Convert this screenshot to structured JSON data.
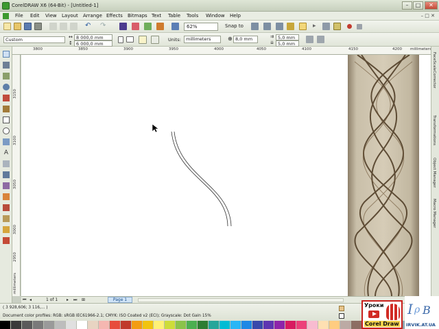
{
  "window": {
    "title": "CorelDRAW X6 (64-Bit) - [Untitled-1]"
  },
  "menu": {
    "items": [
      "File",
      "Edit",
      "View",
      "Layout",
      "Arrange",
      "Effects",
      "Bitmaps",
      "Text",
      "Table",
      "Tools",
      "Window",
      "Help"
    ]
  },
  "std_toolbar": {
    "zoom": "62%",
    "snap_to": "Snap to"
  },
  "property_bar": {
    "preset": "Custom",
    "page_width": "8 000,0 mm",
    "page_height": "6 000,0 mm",
    "units_label": "Units:",
    "units_value": "millimeters",
    "nudge": "8,0 mm",
    "dup_x": "5,0 mm",
    "dup_y": "5,0 mm"
  },
  "hruler": {
    "labels": [
      "3800",
      "3850",
      "3900",
      "3950",
      "4000",
      "4050",
      "4100",
      "4150",
      "4200"
    ],
    "unit": "millimeters"
  },
  "vruler": {
    "labels": [
      "3150",
      "3100",
      "3050",
      "3000",
      "2950",
      "2900"
    ],
    "unit": "millimeters"
  },
  "docker_tabs": [
    "FaceScaleCorrector",
    "Transformations",
    "Object Manager",
    "Macro Manager"
  ],
  "page_nav": {
    "counter": "1 of 1",
    "page_tab": "Page 1"
  },
  "status": {
    "coords": "( 3 928,606; 3 116,... )",
    "color_profiles": "Document color profiles: RGB: sRGB IEC61966-2.1; CMYK: ISO Coated v2 (ECI); Grayscale: Dot Gain 15%"
  },
  "logos": {
    "uroki_line1": "Уроки",
    "uroki_line2": "Corel Draw",
    "irvik_text": "IRVIK.AT.UA"
  },
  "palette": [
    "#000000",
    "#3a3a3a",
    "#5a5a5a",
    "#7a7a7a",
    "#9a9a9a",
    "#bdbdbd",
    "#e0e0e0",
    "#ffffff",
    "#e8d4c2",
    "#f5b7b1",
    "#e74c3c",
    "#c0392b",
    "#f39c12",
    "#f1c40f",
    "#fff176",
    "#cddc39",
    "#8bc34a",
    "#4caf50",
    "#2e7d32",
    "#26a69a",
    "#00bcd4",
    "#29b6f6",
    "#1e88e5",
    "#3949ab",
    "#5e35b1",
    "#8e24aa",
    "#d81b60",
    "#ec407a",
    "#f8bbd0",
    "#ffe0b2",
    "#ffcc80",
    "#bcaaa4",
    "#8d6e63",
    "#5d4037",
    "#a1887f",
    "#cfd8dc",
    "#90a4ae",
    "#546e7a",
    "#b3e5fc",
    "#c8e6c9"
  ]
}
